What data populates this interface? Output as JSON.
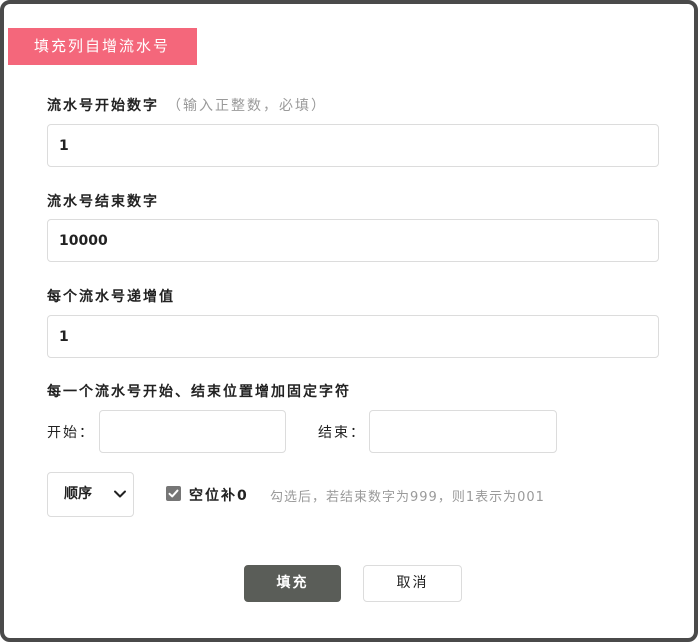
{
  "dialog": {
    "title": "填充列自增流水号"
  },
  "start_number": {
    "label": "流水号开始数字",
    "hint": "（输入正整数，必填）",
    "value": "1"
  },
  "end_number": {
    "label": "流水号结束数字",
    "value": "10000"
  },
  "increment": {
    "label": "每个流水号递增值",
    "value": "1"
  },
  "affix": {
    "label": "每一个流水号开始、结束位置增加固定字符",
    "prefix_label": "开始：",
    "prefix_value": "",
    "suffix_label": "结束：",
    "suffix_value": ""
  },
  "order": {
    "selected": "顺序"
  },
  "zero_pad": {
    "checked": true,
    "label": "空位补0",
    "hint": "勾选后，若结束数字为999，则1表示为001"
  },
  "buttons": {
    "fill_label": "填充",
    "cancel_label": "取消"
  },
  "colors": {
    "title_tag_bg": "#f4677b",
    "primary_button_bg": "#5a5d58",
    "checkbox_bg": "#767676"
  },
  "icons": {
    "select_arrow": "chevron-down-icon",
    "checkbox_mark": "checkmark-icon"
  }
}
